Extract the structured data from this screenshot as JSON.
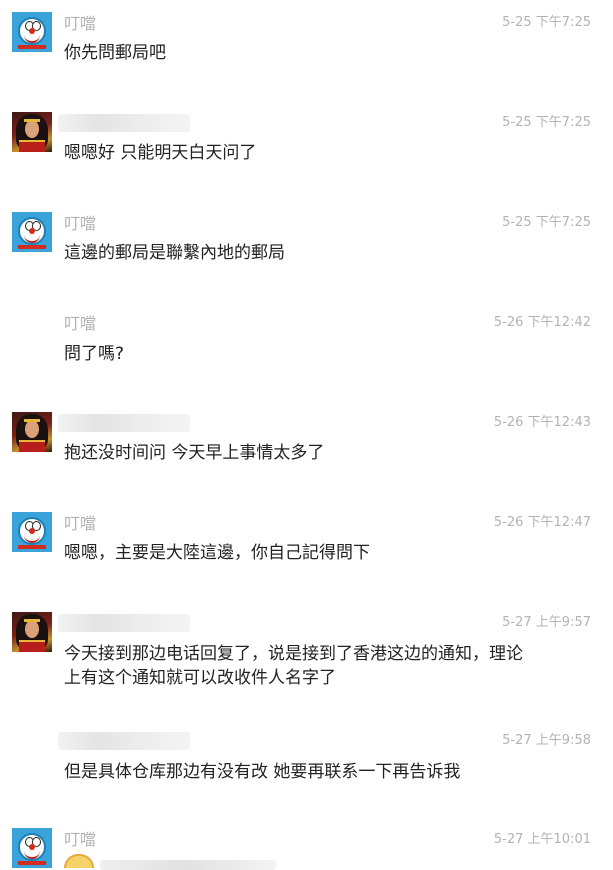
{
  "messages": [
    {
      "sender": "叮噹",
      "time": "5-25 下午7:25",
      "text": "你先問郵局吧"
    },
    {
      "sender": "",
      "time": "5-25 下午7:25",
      "text": "嗯嗯好 只能明天白天问了"
    },
    {
      "sender": "叮噹",
      "time": "5-25 下午7:25",
      "text": "這邊的郵局是聯繫內地的郵局"
    },
    {
      "sender": "叮噹",
      "time": "5-26 下午12:42",
      "text": "問了嗎?"
    },
    {
      "sender": "",
      "time": "5-26 下午12:43",
      "text": "抱还没时间问 今天早上事情太多了"
    },
    {
      "sender": "叮噹",
      "time": "5-26 下午12:47",
      "text": "嗯嗯，主要是大陸這邊，你自己記得問下"
    },
    {
      "sender": "",
      "time": "5-27 上午9:57",
      "text_line1": "今天接到那边电话回复了，说是接到了香港这边的通知，理论",
      "text_line2": "上有这个通知就可以改收件人名字了"
    },
    {
      "sender": "",
      "time": "5-27 上午9:58",
      "text": "但是具体仓库那边有没有改 她要再联系一下再告诉我"
    },
    {
      "sender": "叮噹",
      "time": "5-27 上午10:01"
    }
  ],
  "icons": {
    "contact_avatar": "doraemon-avatar-icon",
    "self_avatar": "wonder-woman-avatar-icon",
    "sticker": "emoji-sticker-icon"
  }
}
